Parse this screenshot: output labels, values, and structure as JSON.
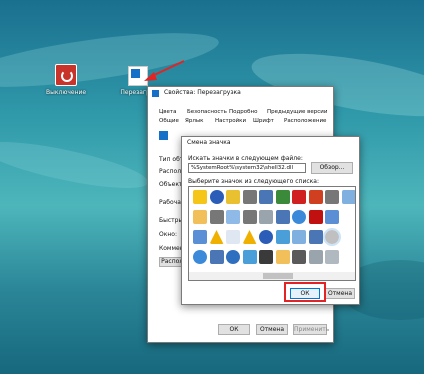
{
  "desktop": {
    "shutdown_label": "Выключение",
    "restart_label": "Перезагр..."
  },
  "props_window": {
    "title": "Свойства: Перезагрузка",
    "tabs_row1": [
      "Цвета",
      "Безопасность",
      "Подробно",
      "Предыдущие версии"
    ],
    "tabs_row2": [
      "Общие",
      "Ярлык",
      "Настройки",
      "Шрифт",
      "Расположение"
    ],
    "side_labels": [
      "Тип объе",
      "Располо",
      "Объект:",
      "Рабочая п",
      "Быстрый",
      "Окно:",
      "Коммент"
    ],
    "side_button": "Располо",
    "ok": "ОК",
    "cancel": "Отмена",
    "apply": "Применить"
  },
  "change_icon_dialog": {
    "title": "Смена значка",
    "file_label": "Искать значки в следующем файле:",
    "file_value": "%SystemRoot%\\system32\\shell32.dll",
    "browse": "Обзор...",
    "list_label": "Выберите значок из следующего списка:",
    "ok": "ОК",
    "cancel": "Отмена"
  },
  "icon_names": [
    "star-icon",
    "folder-icon",
    "monitor-icon",
    "globe-icon",
    "help-icon",
    "printer-icon",
    "warning-icon",
    "computer-icon",
    "shield-icon",
    "search-icon",
    "document-icon",
    "info-icon",
    "printer-icon",
    "printer-icon",
    "warning-icon",
    "network-icon",
    "computer-icon",
    "drive-icon",
    "help-icon",
    "disk-icon",
    "books-icon",
    "computer-icon",
    "network-icon",
    "folder-icon",
    "delete-icon",
    "globe-icon",
    "cloud-icon",
    "camera-icon",
    "power-icon",
    "stop-icon",
    "computer-icon",
    "drive-icon",
    "printer-icon",
    "monitor-icon",
    "disc-icon",
    "eject-icon",
    "cloud-icon"
  ],
  "colors": {
    "accent_red": "#e22424",
    "select_blue": "#cce4f7"
  }
}
